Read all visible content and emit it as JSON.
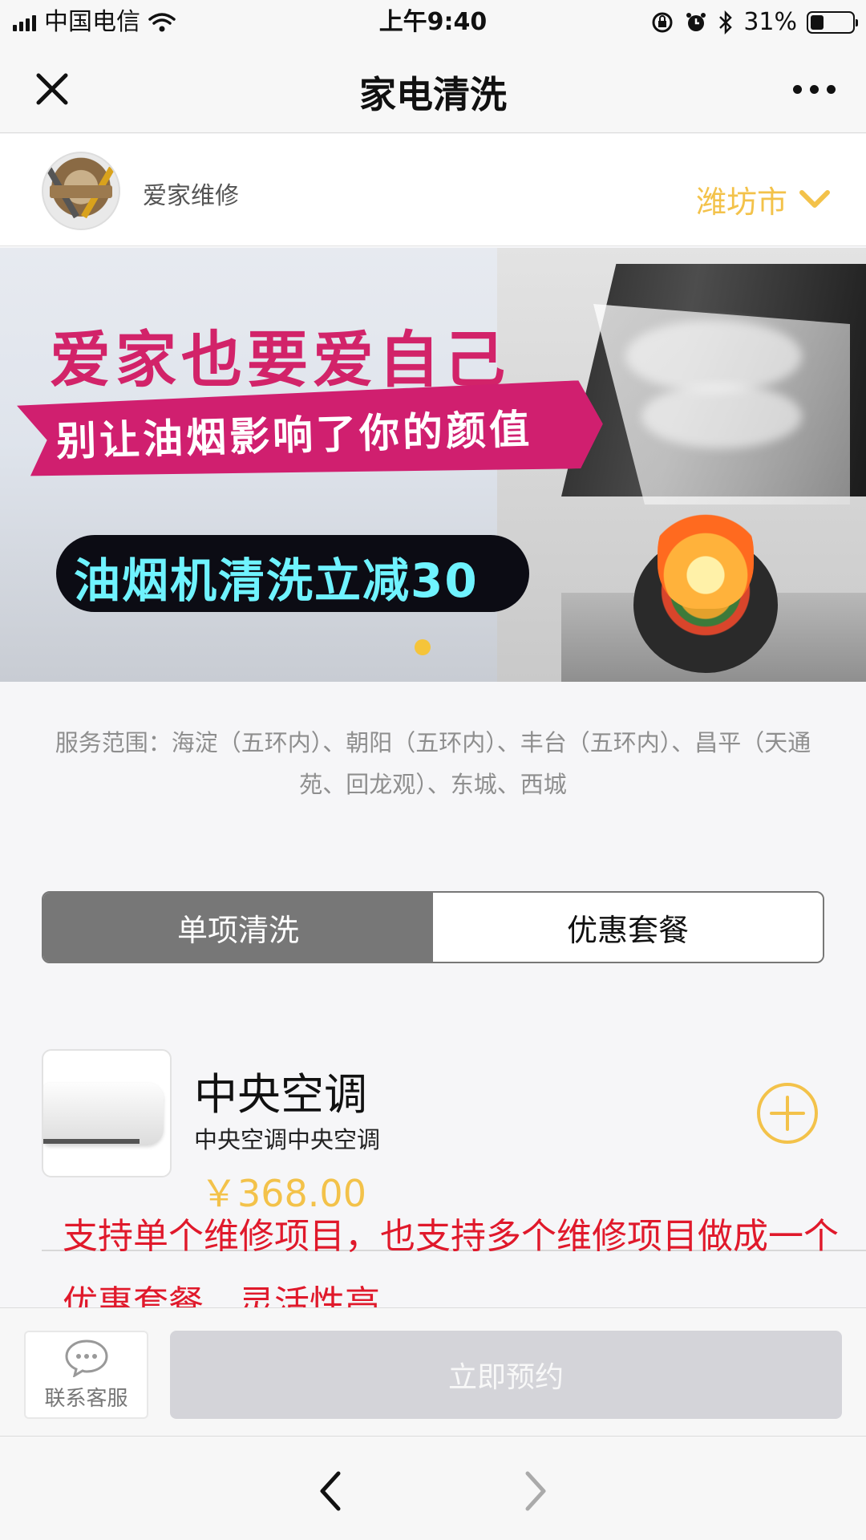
{
  "status_bar": {
    "carrier": "中国电信",
    "time": "上午9:40",
    "battery": "31%",
    "battery_level": 0.31
  },
  "nav": {
    "title": "家电清洗"
  },
  "store": {
    "name": "爱家维修",
    "city": "潍坊市"
  },
  "banner": {
    "headline": "爱家也要爱自己",
    "ribbon": "别让油烟影响了你的颜值",
    "promo": "油烟机清洗立减30"
  },
  "scope": {
    "text": "服务范围：海淀（五环内）、朝阳（五环内）、丰台（五环内）、昌平（天通苑、回龙观）、东城、西城"
  },
  "tabs": {
    "single": "单项清洗",
    "package": "优惠套餐"
  },
  "product": {
    "name": "中央空调",
    "desc": "中央空调中央空调",
    "price": "￥368.00"
  },
  "annotation": "支持单个维修项目，也支持多个维修项目做成一个优惠套餐，灵活性高",
  "actions": {
    "service_label": "联系客服",
    "book_label": "立即预约"
  },
  "colors": {
    "accent": "#f3c24a",
    "annotation": "#e0192b",
    "tab_active": "#777777"
  }
}
